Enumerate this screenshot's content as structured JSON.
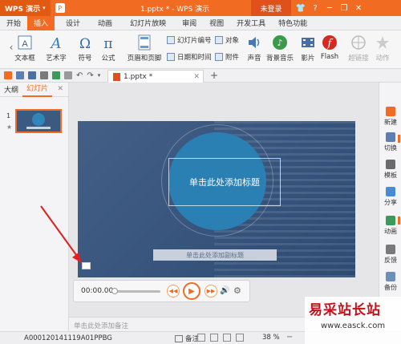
{
  "titlebar": {
    "app_label": "WPS 演示",
    "window_title": "1.pptx * - WPS 演示",
    "login_label": "未登录"
  },
  "menu": {
    "tabs": [
      "开始",
      "插入",
      "设计",
      "动画",
      "幻灯片放映",
      "审阅",
      "视图",
      "开发工具",
      "特色功能"
    ],
    "active": "插入"
  },
  "ribbon": {
    "textbox": "文本框",
    "art_text": "艺术字",
    "symbol": "符号",
    "formula": "公式",
    "header_footer": "页眉和页脚",
    "slide_number": "幻灯片编号",
    "date_time": "日期和时间",
    "object": "对象",
    "attachment": "附件",
    "sound": "声音",
    "bg_music": "背景音乐",
    "movie": "影片",
    "flash": "Flash",
    "hyperlink": "超链接",
    "action": "动作"
  },
  "file_tab": {
    "name": "1.pptx *"
  },
  "left_panel": {
    "tab_outline": "大纲",
    "tab_slides": "幻灯片",
    "slide_number": "1"
  },
  "slide": {
    "title_placeholder": "单击此处添加标题",
    "subtitle_placeholder": "单击此处添加副标题"
  },
  "media": {
    "time": "00:00.00"
  },
  "notes_placeholder": "单击此处添加备注",
  "right_panel": {
    "items": [
      "新建",
      "切换",
      "模板",
      "分享",
      "动画",
      "反馈",
      "备份"
    ]
  },
  "status": {
    "file_id": "A000120141119A01PPBG",
    "notes_label": "备注",
    "zoom": "38 %"
  },
  "watermark": {
    "brand": "易采站长站",
    "url": "www.easck.com"
  }
}
